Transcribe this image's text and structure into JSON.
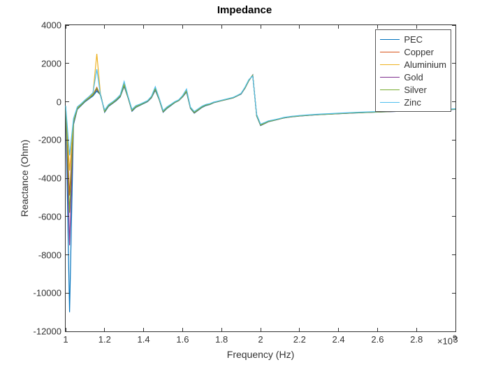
{
  "chart_data": {
    "type": "line",
    "title": "Impedance",
    "xlabel": "Frequency (Hz)",
    "ylabel": "Reactance (Ohm)",
    "xlim": [
      1000000000.0,
      3000000000.0
    ],
    "ylim": [
      -12000,
      4000
    ],
    "x_exponent_label": "×10^9",
    "x_ticks": [
      1000000000.0,
      1200000000.0,
      1400000000.0,
      1600000000.0,
      1800000000.0,
      2000000000.0,
      2200000000.0,
      2400000000.0,
      2600000000.0,
      2800000000.0,
      3000000000.0
    ],
    "x_tick_labels": [
      "1",
      "1.2",
      "1.4",
      "1.6",
      "1.8",
      "2",
      "2.2",
      "2.4",
      "2.6",
      "2.8",
      "3"
    ],
    "y_ticks": [
      -12000,
      -10000,
      -8000,
      -6000,
      -4000,
      -2000,
      0,
      2000,
      4000
    ],
    "y_tick_labels": [
      "-12000",
      "-10000",
      "-8000",
      "-6000",
      "-4000",
      "-2000",
      "0",
      "2000",
      "4000"
    ],
    "legend_position": "northeast",
    "colors": {
      "PEC": "#0072BD",
      "Copper": "#D95319",
      "Aluminium": "#EDB120",
      "Gold": "#7E2F8E",
      "Silver": "#77AC30",
      "Zinc": "#4DBEEE"
    },
    "x": [
      1000000000.0,
      1020000000.0,
      1040000000.0,
      1060000000.0,
      1080000000.0,
      1100000000.0,
      1120000000.0,
      1140000000.0,
      1160000000.0,
      1180000000.0,
      1200000000.0,
      1220000000.0,
      1240000000.0,
      1260000000.0,
      1280000000.0,
      1300000000.0,
      1320000000.0,
      1340000000.0,
      1360000000.0,
      1380000000.0,
      1400000000.0,
      1420000000.0,
      1440000000.0,
      1460000000.0,
      1480000000.0,
      1500000000.0,
      1520000000.0,
      1540000000.0,
      1560000000.0,
      1580000000.0,
      1600000000.0,
      1620000000.0,
      1640000000.0,
      1660000000.0,
      1680000000.0,
      1700000000.0,
      1720000000.0,
      1740000000.0,
      1760000000.0,
      1780000000.0,
      1800000000.0,
      1820000000.0,
      1840000000.0,
      1860000000.0,
      1880000000.0,
      1900000000.0,
      1920000000.0,
      1940000000.0,
      1960000000.0,
      1980000000.0,
      2000000000.0,
      2020000000.0,
      2040000000.0,
      2060000000.0,
      2080000000.0,
      2100000000.0,
      2120000000.0,
      2140000000.0,
      2160000000.0,
      2180000000.0,
      2200000000.0,
      2240000000.0,
      2280000000.0,
      2320000000.0,
      2360000000.0,
      2400000000.0,
      2440000000.0,
      2480000000.0,
      2560000000.0,
      2640000000.0,
      2720000000.0,
      2800000000.0,
      2880000000.0,
      2960000000.0,
      3000000000.0
    ],
    "series": [
      {
        "name": "PEC",
        "values": [
          -300,
          -11000,
          -1200,
          -400,
          -200,
          0,
          150,
          300,
          550,
          350,
          -550,
          -250,
          -100,
          50,
          250,
          800,
          200,
          -500,
          -300,
          -200,
          -100,
          0,
          200,
          600,
          100,
          -550,
          -350,
          -200,
          -50,
          50,
          250,
          500,
          -350,
          -600,
          -450,
          -300,
          -200,
          -150,
          -50,
          0,
          50,
          100,
          150,
          200,
          300,
          400,
          700,
          1100,
          1400,
          -750,
          -1250,
          -1150,
          -1050,
          -1000,
          -950,
          -900,
          -850,
          -820,
          -790,
          -770,
          -750,
          -720,
          -690,
          -670,
          -650,
          -630,
          -610,
          -590,
          -560,
          -530,
          -500,
          -480,
          -450,
          -420,
          -400
        ]
      },
      {
        "name": "Copper",
        "values": [
          -250,
          -4900,
          -1050,
          -350,
          -150,
          50,
          200,
          380,
          750,
          300,
          -500,
          -200,
          -60,
          100,
          300,
          900,
          230,
          -450,
          -260,
          -170,
          -70,
          30,
          240,
          680,
          130,
          -510,
          -320,
          -170,
          -30,
          70,
          280,
          560,
          -320,
          -560,
          -420,
          -270,
          -170,
          -130,
          -40,
          10,
          60,
          110,
          160,
          210,
          310,
          420,
          720,
          1120,
          1380,
          -710,
          -1220,
          -1130,
          -1030,
          -990,
          -940,
          -890,
          -840,
          -810,
          -780,
          -760,
          -740,
          -710,
          -680,
          -660,
          -640,
          -620,
          -600,
          -580,
          -550,
          -520,
          -490,
          -470,
          -440,
          -410,
          -390
        ]
      },
      {
        "name": "Aluminium",
        "values": [
          -230,
          -3600,
          -950,
          -300,
          -120,
          80,
          240,
          430,
          2500,
          260,
          -460,
          -170,
          -30,
          130,
          330,
          980,
          260,
          -420,
          -230,
          -150,
          -50,
          50,
          270,
          730,
          160,
          -480,
          -290,
          -150,
          -10,
          90,
          300,
          610,
          -300,
          -530,
          -390,
          -250,
          -150,
          -110,
          -30,
          20,
          70,
          120,
          170,
          220,
          320,
          430,
          740,
          1140,
          1360,
          -680,
          -1190,
          -1110,
          -1010,
          -970,
          -930,
          -880,
          -830,
          -800,
          -770,
          -750,
          -730,
          -700,
          -670,
          -650,
          -630,
          -610,
          -590,
          -570,
          -540,
          -510,
          -480,
          -460,
          -430,
          -400,
          -380
        ]
      },
      {
        "name": "Gold",
        "values": [
          -280,
          -7500,
          -1120,
          -370,
          -170,
          30,
          180,
          350,
          640,
          320,
          -520,
          -220,
          -80,
          80,
          280,
          850,
          210,
          -470,
          -280,
          -180,
          -80,
          20,
          220,
          640,
          110,
          -530,
          -330,
          -180,
          -40,
          60,
          260,
          530,
          -330,
          -580,
          -430,
          -280,
          -180,
          -140,
          -45,
          5,
          55,
          105,
          155,
          205,
          305,
          410,
          710,
          1110,
          1390,
          -730,
          -1230,
          -1140,
          -1040,
          -995,
          -945,
          -895,
          -845,
          -815,
          -785,
          -765,
          -745,
          -715,
          -685,
          -665,
          -645,
          -625,
          -605,
          -585,
          -555,
          -525,
          -495,
          -475,
          -445,
          -415,
          -395
        ]
      },
      {
        "name": "Silver",
        "values": [
          -260,
          -5800,
          -1080,
          -360,
          -160,
          40,
          190,
          360,
          700,
          310,
          -510,
          -210,
          -70,
          90,
          290,
          870,
          220,
          -460,
          -270,
          -175,
          -75,
          25,
          230,
          660,
          120,
          -520,
          -325,
          -175,
          -35,
          65,
          270,
          545,
          -325,
          -570,
          -425,
          -275,
          -175,
          -135,
          -42,
          8,
          58,
          108,
          158,
          208,
          308,
          415,
          715,
          1115,
          1385,
          -720,
          -1225,
          -1135,
          -1035,
          -992,
          -942,
          -892,
          -842,
          -812,
          -782,
          -762,
          -742,
          -712,
          -682,
          -662,
          -642,
          -622,
          -602,
          -582,
          -552,
          -522,
          -492,
          -472,
          -442,
          -412,
          -392
        ]
      },
      {
        "name": "Zinc",
        "values": [
          -210,
          -2800,
          -880,
          -270,
          -100,
          100,
          270,
          470,
          1700,
          240,
          -430,
          -150,
          -10,
          150,
          360,
          1060,
          290,
          -400,
          -210,
          -130,
          -40,
          60,
          290,
          780,
          180,
          -460,
          -270,
          -130,
          5,
          100,
          320,
          660,
          -280,
          -510,
          -370,
          -230,
          -140,
          -100,
          -20,
          30,
          80,
          130,
          180,
          230,
          330,
          440,
          760,
          1160,
          1340,
          -660,
          -1170,
          -1090,
          -1000,
          -960,
          -920,
          -870,
          -820,
          -790,
          -760,
          -740,
          -720,
          -690,
          -660,
          -640,
          -620,
          -600,
          -580,
          -560,
          -530,
          -500,
          -470,
          -450,
          -420,
          -390,
          -370
        ]
      }
    ]
  }
}
